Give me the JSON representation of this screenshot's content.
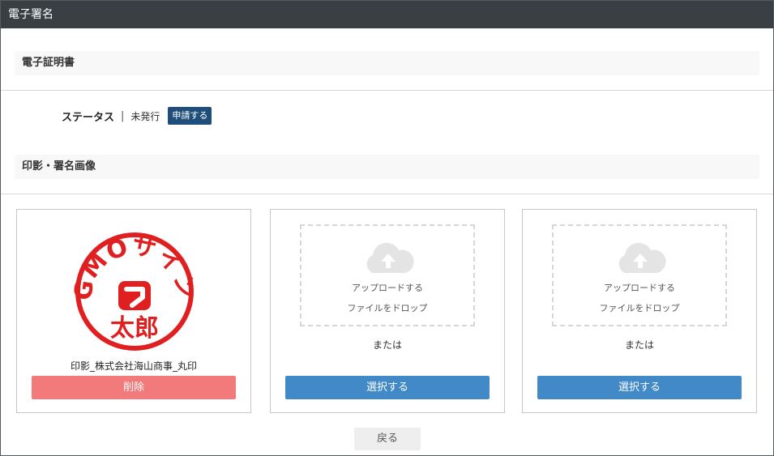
{
  "window": {
    "title": "電子署名"
  },
  "certificate": {
    "section_title": "電子証明書",
    "status_label": "ステータス",
    "status_separator": "|",
    "status_value": "未発行",
    "apply_button": "申請する"
  },
  "stamps": {
    "section_title": "印影・署名画像",
    "cards": [
      {
        "stamp_image": {
          "top_text": "GMOサイン",
          "bottom_text": "太郎",
          "color": "#e02020"
        },
        "caption": "印影_株式会社海山商事_丸印",
        "button": "削除"
      },
      {
        "upload_text": "アップロードする",
        "drop_text": "ファイルをドロップ",
        "or_text": "または",
        "button": "選択する"
      },
      {
        "upload_text": "アップロードする",
        "drop_text": "ファイルをドロップ",
        "or_text": "または",
        "button": "選択する"
      }
    ]
  },
  "footer": {
    "back_button": "戻る"
  },
  "colors": {
    "titlebar": "#3a3f44",
    "apply_button": "#1e4e79",
    "delete_button": "#f27a7a",
    "select_button": "#4189c7",
    "stamp": "#e02020"
  }
}
